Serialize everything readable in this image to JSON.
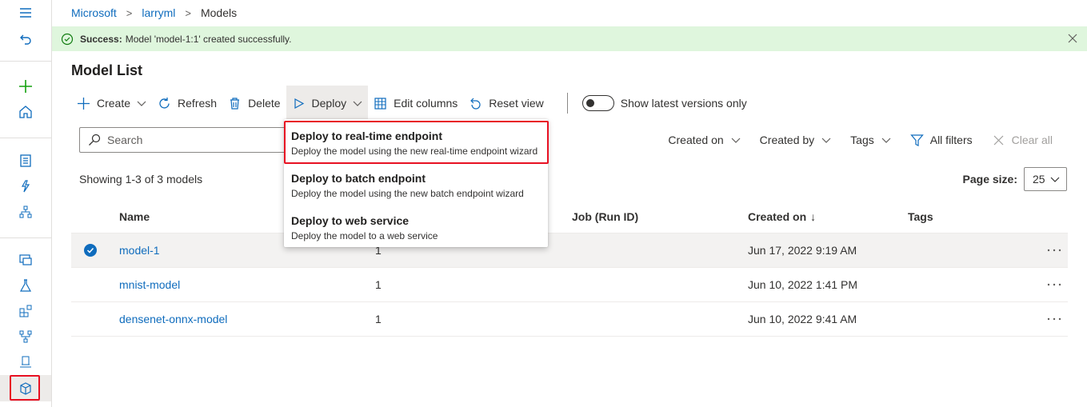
{
  "breadcrumb": {
    "items": [
      "Microsoft",
      "larryml"
    ],
    "current": "Models"
  },
  "message_bar": {
    "status": "Success:",
    "text": "Model 'model-1:1' created successfully."
  },
  "page": {
    "title": "Model List"
  },
  "toolbar": {
    "create": "Create",
    "refresh": "Refresh",
    "delete": "Delete",
    "deploy": "Deploy",
    "edit_columns": "Edit columns",
    "reset_view": "Reset view",
    "toggle_label": "Show latest versions only"
  },
  "search": {
    "placeholder": "Search"
  },
  "filters": {
    "created_on": "Created on",
    "created_by": "Created by",
    "tags": "Tags",
    "all_filters": "All filters",
    "clear_all": "Clear all"
  },
  "listing": {
    "showing": "Showing 1-3 of 3 models",
    "page_size_label": "Page size:",
    "page_size_value": "25"
  },
  "table": {
    "columns": {
      "name": "Name",
      "job": "Job (Run ID)",
      "created_on": "Created on",
      "created_on_sort": "↓",
      "tags": "Tags"
    },
    "rows": [
      {
        "name": "model-1",
        "version": "1",
        "job": "",
        "created_on": "Jun 17, 2022 9:19 AM",
        "tags": "",
        "selected": true
      },
      {
        "name": "mnist-model",
        "version": "1",
        "job": "",
        "created_on": "Jun 10, 2022 1:41 PM",
        "tags": "",
        "selected": false
      },
      {
        "name": "densenet-onnx-model",
        "version": "1",
        "job": "",
        "created_on": "Jun 10, 2022 9:41 AM",
        "tags": "",
        "selected": false
      }
    ]
  },
  "deploy_menu": {
    "items": [
      {
        "title": "Deploy to real-time endpoint",
        "desc": "Deploy the model using the new real-time endpoint wizard"
      },
      {
        "title": "Deploy to batch endpoint",
        "desc": "Deploy the model using the new batch endpoint wizard"
      },
      {
        "title": "Deploy to web service",
        "desc": "Deploy the model to a web service"
      }
    ]
  },
  "colors": {
    "accent": "#0f6cbd",
    "success_bg": "#dff6dd",
    "highlight": "#e81123"
  },
  "icons": {
    "rail": [
      "hamburger-icon",
      "back-icon",
      "add-icon",
      "home-icon",
      "notebook-icon",
      "automl-icon",
      "designer-icon",
      "data-icon",
      "experiment-icon",
      "pipeline-icon",
      "component-icon",
      "environment-icon",
      "models-icon"
    ]
  }
}
